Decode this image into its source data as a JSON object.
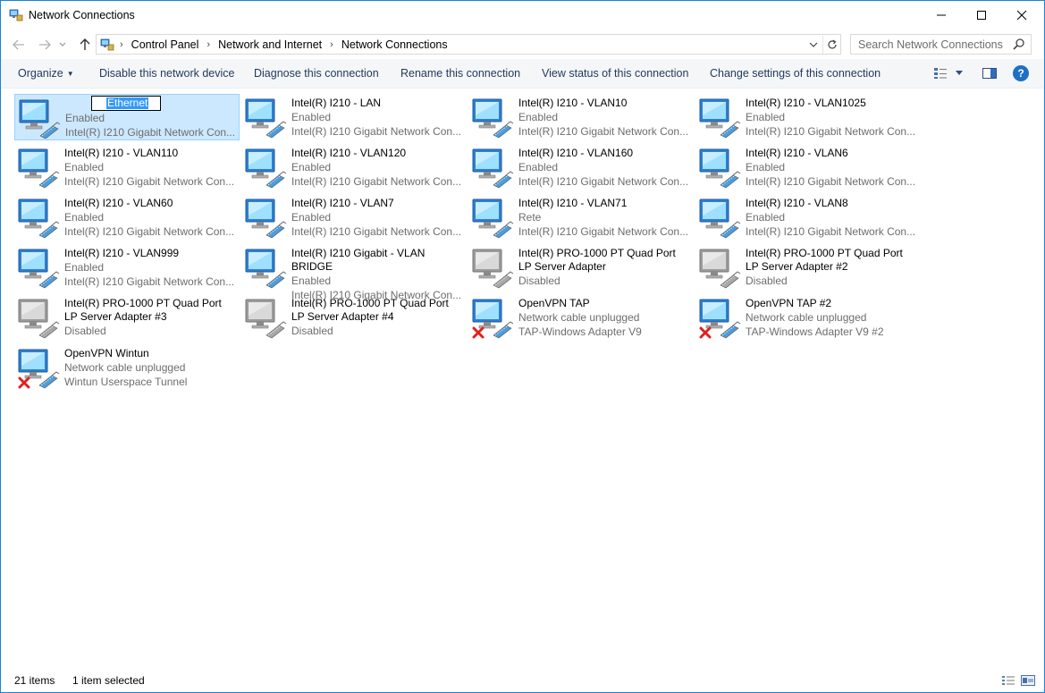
{
  "window": {
    "title": "Network Connections"
  },
  "address": {
    "crumbs": [
      "Control Panel",
      "Network and Internet",
      "Network Connections"
    ]
  },
  "search": {
    "placeholder": "Search Network Connections"
  },
  "toolbar": {
    "organize": "Organize",
    "disable": "Disable this network device",
    "diagnose": "Diagnose this connection",
    "rename": "Rename this connection",
    "view_status": "View status of this connection",
    "change_settings": "Change settings of this connection"
  },
  "items": [
    {
      "name": "Ethernet",
      "status": "Enabled",
      "device": "Intel(R) I210 Gigabit Network Con...",
      "state": "enabled",
      "selected": true,
      "renaming": true
    },
    {
      "name": "Intel(R) I210 - LAN",
      "status": "Enabled",
      "device": "Intel(R) I210 Gigabit Network Con...",
      "state": "enabled"
    },
    {
      "name": "Intel(R) I210 - VLAN10",
      "status": "Enabled",
      "device": "Intel(R) I210 Gigabit Network Con...",
      "state": "enabled"
    },
    {
      "name": "Intel(R) I210 - VLAN1025",
      "status": "Enabled",
      "device": "Intel(R) I210 Gigabit Network Con...",
      "state": "enabled"
    },
    {
      "name": "Intel(R) I210 - VLAN110",
      "status": "Enabled",
      "device": "Intel(R) I210 Gigabit Network Con...",
      "state": "enabled"
    },
    {
      "name": "Intel(R) I210 - VLAN120",
      "status": "Enabled",
      "device": "Intel(R) I210 Gigabit Network Con...",
      "state": "enabled"
    },
    {
      "name": "Intel(R) I210 - VLAN160",
      "status": "Enabled",
      "device": "Intel(R) I210 Gigabit Network Con...",
      "state": "enabled"
    },
    {
      "name": "Intel(R) I210 - VLAN6",
      "status": "Enabled",
      "device": "Intel(R) I210 Gigabit Network Con...",
      "state": "enabled"
    },
    {
      "name": "Intel(R) I210 - VLAN60",
      "status": "Enabled",
      "device": "Intel(R) I210 Gigabit Network Con...",
      "state": "enabled"
    },
    {
      "name": "Intel(R) I210 - VLAN7",
      "status": "Enabled",
      "device": "Intel(R) I210 Gigabit Network Con...",
      "state": "enabled"
    },
    {
      "name": "Intel(R) I210 - VLAN71",
      "status": "Rete",
      "device": "Intel(R) I210 Gigabit Network Con...",
      "state": "enabled"
    },
    {
      "name": "Intel(R) I210 - VLAN8",
      "status": "Enabled",
      "device": "Intel(R) I210 Gigabit Network Con...",
      "state": "enabled"
    },
    {
      "name": "Intel(R) I210 - VLAN999",
      "status": "Enabled",
      "device": "Intel(R) I210 Gigabit Network Con...",
      "state": "enabled"
    },
    {
      "name": "Intel(R) I210 Gigabit - VLAN BRIDGE",
      "status": "Enabled",
      "device": "Intel(R) I210 Gigabit Network Con...",
      "state": "enabled"
    },
    {
      "name": "Intel(R) PRO-1000 PT Quad Port LP Server Adapter",
      "status": "Disabled",
      "device": "",
      "state": "disabled"
    },
    {
      "name": "Intel(R) PRO-1000 PT Quad Port LP Server Adapter #2",
      "status": "Disabled",
      "device": "",
      "state": "disabled"
    },
    {
      "name": "Intel(R) PRO-1000 PT Quad Port LP Server Adapter #3",
      "status": "Disabled",
      "device": "",
      "state": "disabled"
    },
    {
      "name": "Intel(R) PRO-1000 PT Quad Port LP Server Adapter #4",
      "status": "Disabled",
      "device": "",
      "state": "disabled"
    },
    {
      "name": "OpenVPN TAP",
      "status": "Network cable unplugged",
      "device": "TAP-Windows Adapter V9",
      "state": "unplugged"
    },
    {
      "name": "OpenVPN TAP #2",
      "status": "Network cable unplugged",
      "device": "TAP-Windows Adapter V9 #2",
      "state": "unplugged"
    },
    {
      "name": "OpenVPN Wintun",
      "status": "Network cable unplugged",
      "device": "Wintun Userspace Tunnel",
      "state": "unplugged"
    }
  ],
  "status": {
    "count": "21 items",
    "selection": "1 item selected"
  },
  "colors": {
    "accent": "#1883d7",
    "selection_bg": "#cce8ff",
    "selection_border": "#99d1ff",
    "link": "#1e395b",
    "unplugged_x": "#e02020"
  }
}
